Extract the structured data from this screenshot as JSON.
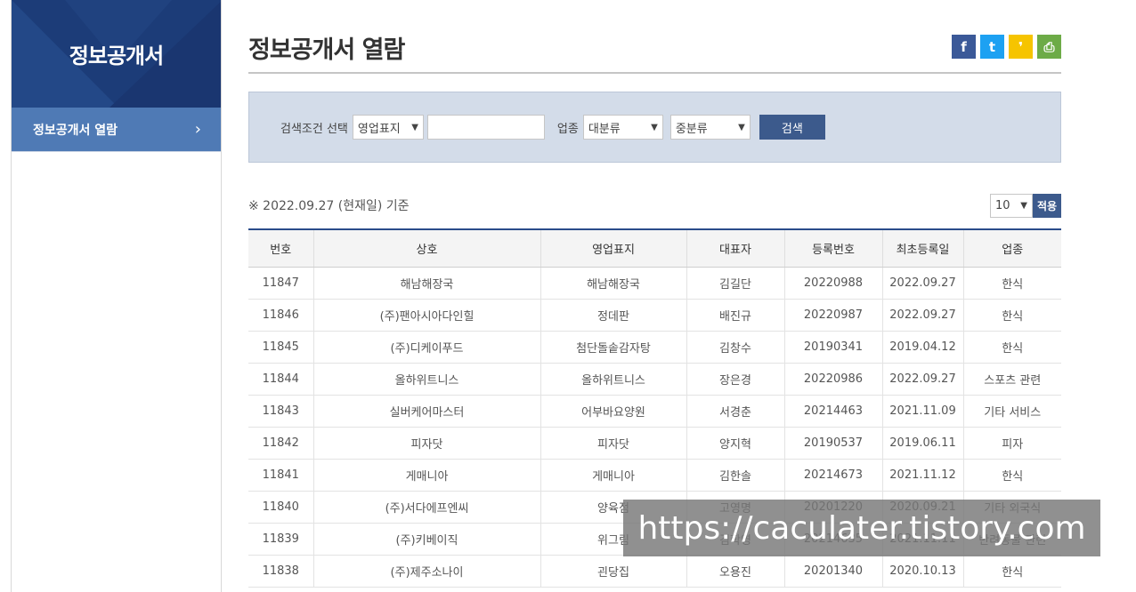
{
  "sidebar": {
    "title": "정보공개서",
    "items": [
      {
        "label": "정보공개서 열람",
        "chevron": "›"
      }
    ]
  },
  "main": {
    "title": "정보공개서 열람",
    "share": {
      "facebook": "f",
      "twitter": "t",
      "kakaostory": "❜",
      "print": "⎙"
    },
    "search": {
      "condition_label": "검색조건 선택",
      "condition_select": "영업표지",
      "keyword_value": "",
      "industry_label": "업종",
      "major_select": "대분류",
      "minor_select": "중분류",
      "button": "검색"
    },
    "base_date": "※ 2022.09.27 (현재일) 기준",
    "per_page": "10",
    "apply": "적용",
    "table": {
      "headers": [
        "번호",
        "상호",
        "영업표지",
        "대표자",
        "등록번호",
        "최초등록일",
        "업종"
      ],
      "rows": [
        [
          "11847",
          "해남해장국",
          "해남해장국",
          "김길단",
          "20220988",
          "2022.09.27",
          "한식"
        ],
        [
          "11846",
          "(주)팬아시아다인힐",
          "정데판",
          "배진규",
          "20220987",
          "2022.09.27",
          "한식"
        ],
        [
          "11845",
          "(주)디케이푸드",
          "첨단돌솥감자탕",
          "김창수",
          "20190341",
          "2019.04.12",
          "한식"
        ],
        [
          "11844",
          "올하위트니스",
          "올하위트니스",
          "장은경",
          "20220986",
          "2022.09.27",
          "스포츠 관련"
        ],
        [
          "11843",
          "실버케어마스터",
          "어부바요양원",
          "서경춘",
          "20214463",
          "2021.11.09",
          "기타 서비스"
        ],
        [
          "11842",
          "피자닷",
          "피자닷",
          "양지혁",
          "20190537",
          "2019.06.11",
          "피자"
        ],
        [
          "11841",
          "게매니아",
          "게매니아",
          "김한솔",
          "20214673",
          "2021.11.12",
          "한식"
        ],
        [
          "11840",
          "(주)서다에프엔씨",
          "양육점",
          "고영명",
          "20201220",
          "2020.09.21",
          "기타 외국식"
        ],
        [
          "11839",
          "(주)키베이직",
          "위그림",
          "김학영",
          "20214635",
          "2021.11.11",
          "반려동물 관련"
        ],
        [
          "11838",
          "(주)제주소나이",
          "괸당집",
          "오용진",
          "20201340",
          "2020.10.13",
          "한식"
        ]
      ]
    }
  },
  "watermark": "https://caculater.tistory.com"
}
